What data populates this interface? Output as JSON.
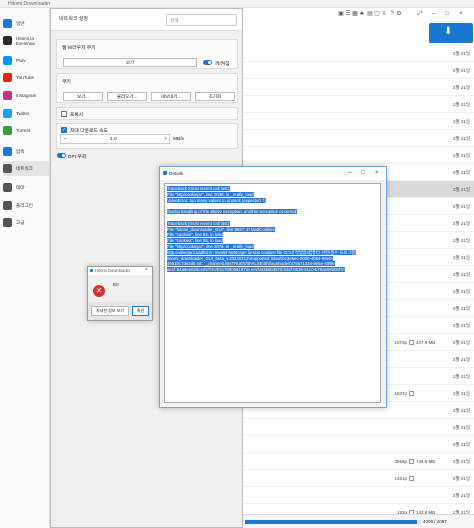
{
  "main_window": {
    "title": "Hitomi Downloader",
    "toolbar_icons": [
      "save-icon",
      "list-icon",
      "grid-icon",
      "cart-icon",
      "table-icon",
      "window-icon",
      "menu-icon",
      "help-icon",
      "gear-icon",
      "fullscreen-icon",
      "minimize-icon",
      "maximize-icon",
      "close-icon"
    ]
  },
  "sidebar": {
    "items": [
      {
        "label": "일반",
        "icon": "home-icon",
        "color": "#1b78d0"
      },
      {
        "label": "Hitomi.la\nExHentai",
        "icon": "h-logo-icon",
        "color": "#2b2b2b"
      },
      {
        "label": "Pixiv",
        "icon": "pixiv-icon",
        "color": "#0096fa"
      },
      {
        "label": "YouTube",
        "icon": "youtube-icon",
        "color": "#e62117"
      },
      {
        "label": "Instagram",
        "icon": "instagram-icon",
        "color": "#c13584"
      },
      {
        "label": "Twitter",
        "icon": "twitter-icon",
        "color": "#1da1f2"
      },
      {
        "label": "Torrent",
        "icon": "torrent-icon",
        "color": "#3a9e3a"
      },
      {
        "label": "압축",
        "icon": "archive-icon",
        "color": "#1b78d0"
      },
      {
        "label": "네트워크",
        "icon": "network-icon",
        "color": "#555555"
      },
      {
        "label": "테마",
        "icon": "palette-icon",
        "color": "#555555"
      },
      {
        "label": "플러그인",
        "icon": "plugin-icon",
        "color": "#555555"
      },
      {
        "label": "고급",
        "icon": "advanced-icon",
        "color": "#555555"
      }
    ],
    "active_index": 8
  },
  "settings": {
    "title": "네트워크 설정",
    "search_placeholder": "검색",
    "proxy_group": {
      "title": "웹 브라우저 쿠키",
      "view_button": "보기",
      "toggle_label": "꺼/켜짐"
    },
    "cookie_group": {
      "title": "쿠키",
      "buttons": [
        "보기...",
        "불러오기...",
        "내보내기...",
        "초기화"
      ]
    },
    "proxy_checkbox": {
      "label": "프록시",
      "checked": false
    },
    "speed_limit": {
      "label": "최대 다운로드 속도",
      "checked": true,
      "minus": "−",
      "value": "1.0",
      "plus": "+",
      "unit": "MB/s"
    },
    "dpi_toggle": {
      "label": "DPI 우회"
    }
  },
  "details_dialog": {
    "title": "Details",
    "lines": [
      "Traceback (most recent call last):",
      "  File \"http/cookiejar\", line 2038, in _really_load",
      "ValueError: too many values to unpack (expected 7)",
      "",
      "During handling of the above exception, another exception occurred:",
      "",
      "Traceback (most recent call last):",
      "  File \"hitomi_downloader_GUI\", line 9557, in loadCookies",
      "  File \"cookies\", line 84, in load",
      "  File \"cookies\", line 55, in load",
      "  File \"http/cookiejar\", line 2076, in _really_load",
      "http.cookiejar.LoadError: invalid Netscape format cookies file 'D:\\내 작업용\\컴퓨터 관련\\필수 프로그램\\",
      "hitomi_downloader_GUI_beta_v.20230212\\Supported Sites\\fcc3e5ec-0000-4b64-99e0-",
      "4651bc7de2d8.txt': '_channelListsTRUE\\t/\\tFALSE\\t0\\tlocalnode\\t\\t75671334-8e5e-4086-",
      "ae1f-54a8ee826ce2\\tTRUE\\t1709059197\\tv.vvvl\\t43b5b3570.b3af-6535-91c0-b79ae582bbf'\\n'"
    ]
  },
  "error_dialog": {
    "title": "Hitomi Downloader",
    "message": "Err",
    "details_button": "자세한 정보 보기",
    "ok_button": "확인"
  },
  "download_list": {
    "rows": [
      {
        "pages": "",
        "size": "",
        "date": "2월 21일"
      },
      {
        "pages": "",
        "size": "",
        "date": "2월 21일"
      },
      {
        "pages": "",
        "size": "",
        "date": "2월 21일"
      },
      {
        "pages": "",
        "size": "",
        "date": "2월 21일"
      },
      {
        "pages": "",
        "size": "",
        "date": "2월 21일"
      },
      {
        "pages": "",
        "size": "",
        "date": "2월 21일"
      },
      {
        "pages": "",
        "size": "",
        "date": "2월 21일"
      },
      {
        "pages": "",
        "size": "",
        "date": "2월 21일"
      },
      {
        "pages": "",
        "size": "",
        "date": "2월 21일",
        "selected": true
      },
      {
        "pages": "",
        "size": "",
        "date": "2월 21일"
      },
      {
        "pages": "",
        "size": "",
        "date": "2월 21일"
      },
      {
        "pages": "",
        "size": "",
        "date": "2월 21일"
      },
      {
        "pages": "",
        "size": "",
        "date": "2월 21일"
      },
      {
        "pages": "",
        "size": "",
        "date": "2월 21일"
      },
      {
        "pages": "",
        "size": "",
        "date": "2월 21일"
      },
      {
        "pages": "",
        "size": "",
        "date": "2월 21일"
      },
      {
        "pages": "",
        "size": "",
        "date": "2월 21일"
      },
      {
        "pages": "1870p",
        "size": "437.9 MB",
        "date": "2월 21일"
      },
      {
        "pages": "",
        "size": "",
        "date": "2월 21일"
      },
      {
        "pages": "",
        "size": "",
        "date": "2월 21일"
      },
      {
        "pages": "1637p",
        "size": "",
        "date": "2월 21일"
      },
      {
        "pages": "",
        "size": "",
        "date": "2월 21일"
      },
      {
        "pages": "",
        "size": "",
        "date": "2월 21일"
      },
      {
        "pages": "",
        "size": "",
        "date": "2월 21일"
      },
      {
        "pages": "3555p",
        "size": "746.8 MB",
        "date": "2월 21일"
      },
      {
        "pages": "1461p",
        "size": "",
        "date": "2월 21일"
      },
      {
        "pages": "",
        "size": "",
        "date": "2월 21일"
      },
      {
        "pages": "192p",
        "size": "143.8 MB",
        "date": "2월 21일"
      }
    ],
    "extra_labels": {
      "row20": "Ingrid",
      "row21_size": "16.4 MB",
      "row26_date": "9월 19, 2021",
      "row25_size": "78.1 MB"
    },
    "status_count": "4008 / 4087",
    "progress_fraction": 0.98,
    "download_icon": "download-icon"
  }
}
